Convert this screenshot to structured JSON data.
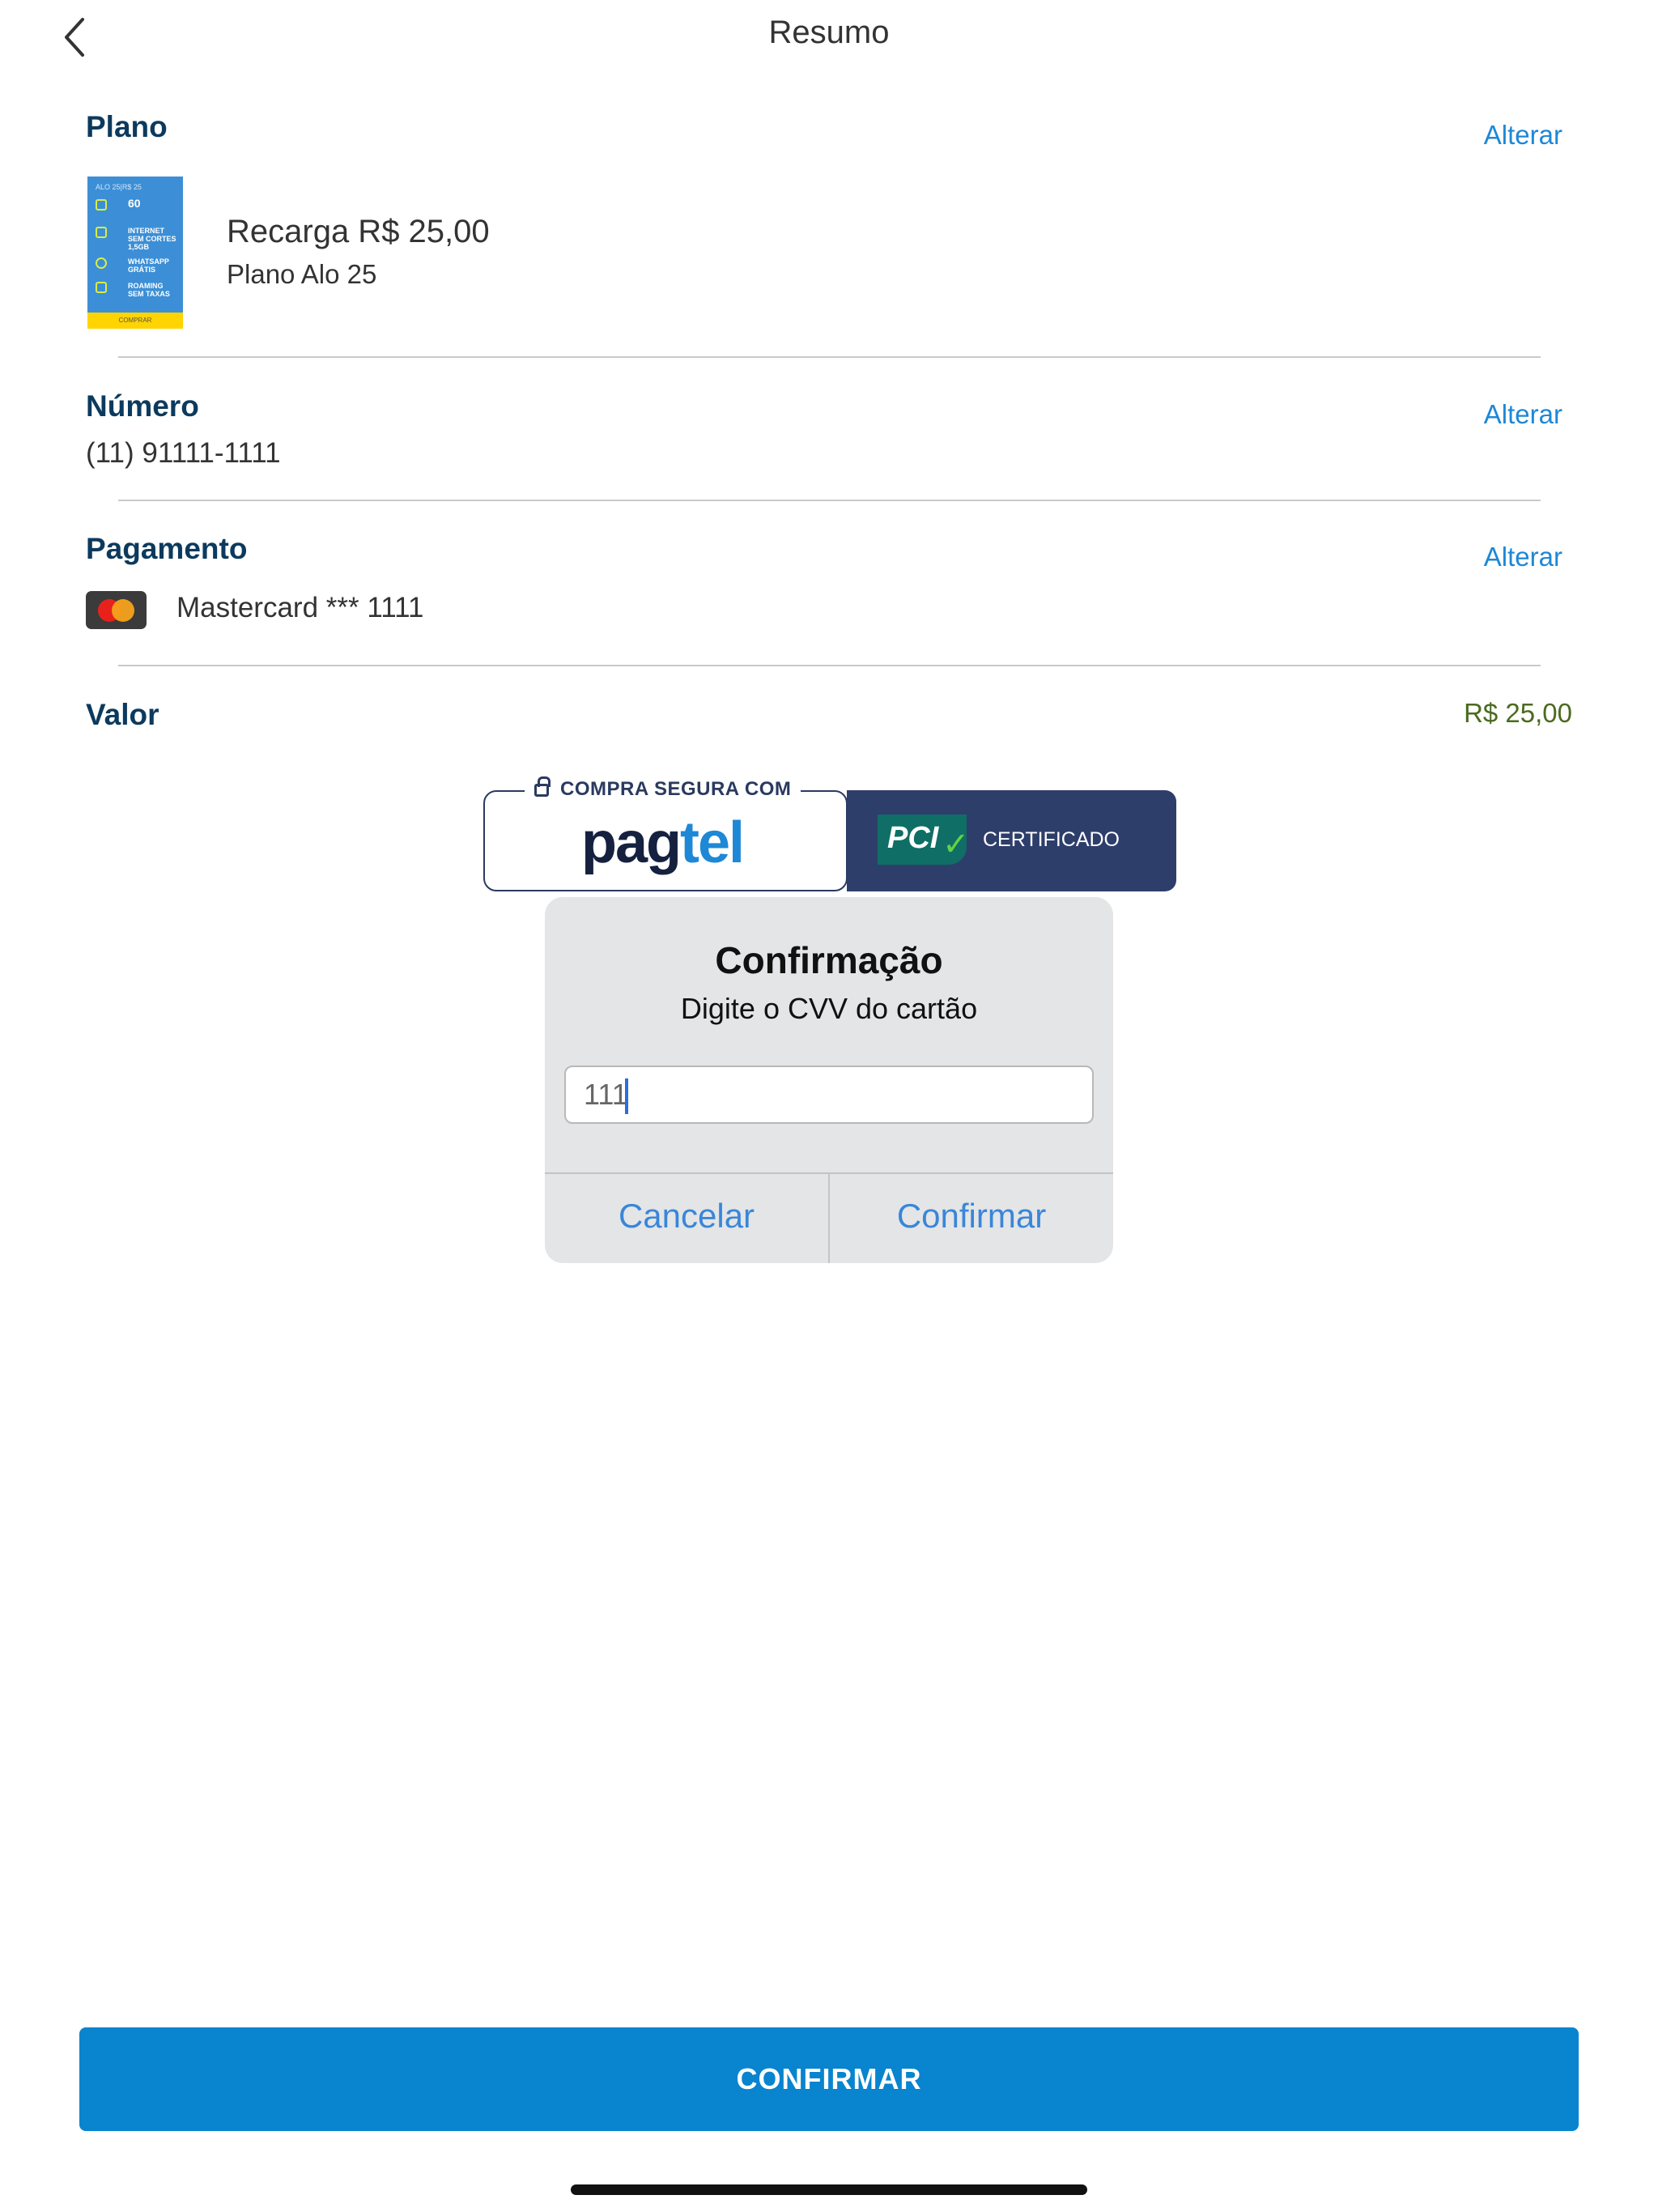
{
  "header": {
    "title": "Resumo"
  },
  "plano": {
    "title": "Plano",
    "change_label": "Alterar",
    "name": "Recarga R$ 25,00",
    "subtitle": "Plano Alo 25",
    "thumb": {
      "header": "ALO 25|R$ 25",
      "rows": [
        "60",
        "INTERNET SEM CORTES 1,5GB",
        "WHATSAPP GRÁTIS",
        "ROAMING SEM TAXAS"
      ],
      "footer": "COMPRAR"
    }
  },
  "numero": {
    "title": "Número",
    "change_label": "Alterar",
    "value": "(11) 91111-1111"
  },
  "pagamento": {
    "title": "Pagamento",
    "change_label": "Alterar",
    "card": "Mastercard *** 1111",
    "card_icon": "mastercard-icon"
  },
  "valor": {
    "title": "Valor",
    "amount": "R$ 25,00"
  },
  "secure_badge": {
    "caption": "COMPRA SEGURA COM",
    "brand_part1": "pag",
    "brand_part2": "tel",
    "pci": "PCI",
    "certified": "CERTIFICADO"
  },
  "dialog": {
    "title": "Confirmação",
    "message": "Digite o CVV do cartão",
    "input_value": "111",
    "cancel_label": "Cancelar",
    "confirm_label": "Confirmar"
  },
  "footer": {
    "confirm_label": "CONFIRMAR"
  },
  "colors": {
    "primary": "#0984ce",
    "link": "#1e88d6",
    "section_title": "#0c3a5e",
    "amount": "#4b6b1f",
    "badge_dark": "#2e3e6b"
  }
}
